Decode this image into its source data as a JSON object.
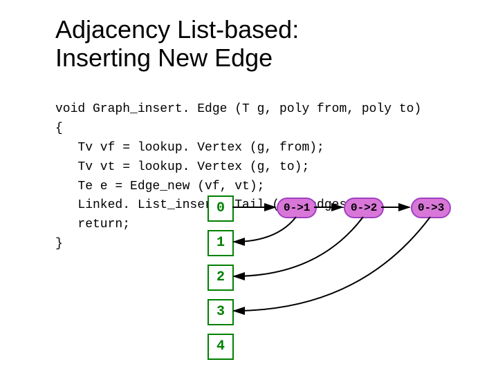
{
  "title_line1": "Adjacency List-based:",
  "title_line2": "Inserting New Edge",
  "code": "void Graph_insert. Edge (T g, poly from, poly to)\n{\n   Tv vf = lookup. Vertex (g, from);\n   Tv vt = lookup. Vertex (g, to);\n   Te e = Edge_new (vf, vt);\n   Linked. List_insert. Tail (vf->edges, e);\n   return;\n}",
  "vertices": [
    "0",
    "1",
    "2",
    "3",
    "4"
  ],
  "edges": [
    "0->1",
    "0->2",
    "0->3"
  ],
  "chart_data": {
    "type": "diagram",
    "nodes": [
      0,
      1,
      2,
      3,
      4
    ],
    "edge_list": [
      [
        0,
        1
      ],
      [
        0,
        2
      ],
      [
        0,
        3
      ]
    ],
    "representation": "adjacency-list"
  }
}
